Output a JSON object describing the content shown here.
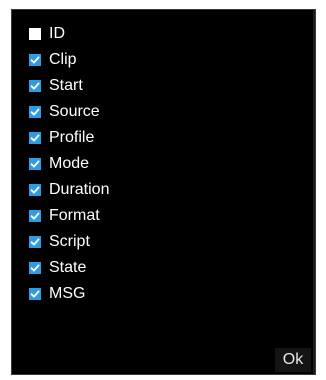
{
  "columns": [
    {
      "label": "ID",
      "checked": false
    },
    {
      "label": "Clip",
      "checked": true
    },
    {
      "label": "Start",
      "checked": true
    },
    {
      "label": "Source",
      "checked": true
    },
    {
      "label": "Profile",
      "checked": true
    },
    {
      "label": "Mode",
      "checked": true
    },
    {
      "label": "Duration",
      "checked": true
    },
    {
      "label": "Format",
      "checked": true
    },
    {
      "label": "Script",
      "checked": true
    },
    {
      "label": "State",
      "checked": true
    },
    {
      "label": "MSG",
      "checked": true
    }
  ],
  "ok_label": "Ok",
  "colors": {
    "panel_bg": "#000000",
    "checkbox_checked": "#2f9be3",
    "checkbox_unchecked": "#ffffff",
    "text": "#ffffff"
  }
}
